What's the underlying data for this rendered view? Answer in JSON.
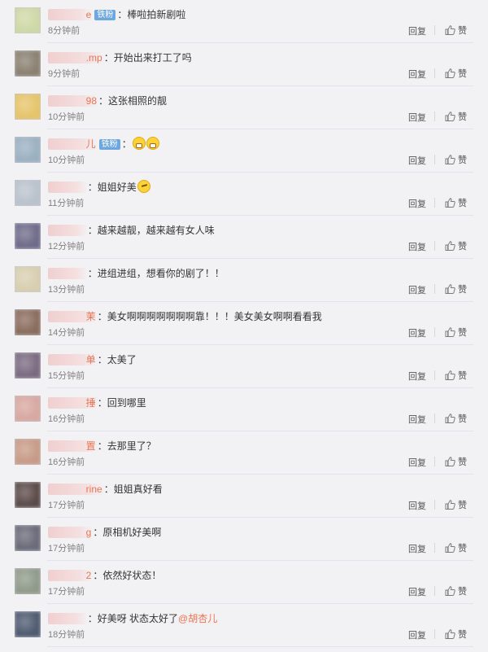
{
  "actions": {
    "reply_label": "回复",
    "like_label": "赞"
  },
  "colors": {
    "name": "#eb7350",
    "badge": "#6ea7df",
    "time": "#808080"
  },
  "comments": [
    {
      "name": "e",
      "badge": "铁粉",
      "text": "：棒啦拍新剧啦",
      "time": "8分钟前",
      "avatar": "#cfd8a6"
    },
    {
      "name": ".mp",
      "badge": "",
      "text": "：开始出来打工了吗",
      "time": "9分钟前",
      "avatar": "#8a8070"
    },
    {
      "name": "98",
      "badge": "",
      "text": "：这张相照的靓",
      "time": "10分钟前",
      "avatar": "#e6c46a"
    },
    {
      "name": "儿",
      "badge": "铁粉",
      "text": "：",
      "emoji": [
        "teeth",
        "teeth"
      ],
      "time": "10分钟前",
      "avatar": "#9ab0c0"
    },
    {
      "name": "",
      "badge": "",
      "text": "：姐姐好美",
      "emoji": [
        "think"
      ],
      "time": "11分钟前",
      "avatar": "#b9c2cc"
    },
    {
      "name": "",
      "badge": "",
      "text": "：越来越靓，越来越有女人味",
      "time": "12分钟前",
      "avatar": "#6e6a88"
    },
    {
      "name": "",
      "badge": "",
      "text": "：进组进组，想看你的剧了！！",
      "time": "13分钟前",
      "avatar": "#d8cfb0"
    },
    {
      "name": "茉",
      "badge": "",
      "text": "：美女啊啊啊啊啊啊啊靠！！！美女美女啊啊看看我",
      "time": "14分钟前",
      "avatar": "#8a6c5c"
    },
    {
      "name": "单",
      "badge": "",
      "text": "：太美了",
      "time": "15分钟前",
      "avatar": "#7a6a80"
    },
    {
      "name": "捶",
      "badge": "",
      "text": "：回到哪里",
      "time": "16分钟前",
      "avatar": "#d8a7a0"
    },
    {
      "name": "置",
      "badge": "",
      "text": "：去那里了？",
      "time": "16分钟前",
      "avatar": "#c79a86"
    },
    {
      "name": "rine",
      "badge": "",
      "text": "：姐姐真好看",
      "time": "17分钟前",
      "avatar": "#5a4a48"
    },
    {
      "name": "g",
      "badge": "",
      "text": "：原相机好美啊",
      "time": "17分钟前",
      "avatar": "#6a6a78"
    },
    {
      "name": "2",
      "badge": "",
      "text": "：依然好状态！",
      "time": "17分钟前",
      "avatar": "#8f9a8a"
    },
    {
      "name": "",
      "badge": "",
      "text": "：好美呀 状态太好了",
      "mention": "@胡杏儿",
      "time": "18分钟前",
      "avatar": "#4e5a70"
    }
  ]
}
